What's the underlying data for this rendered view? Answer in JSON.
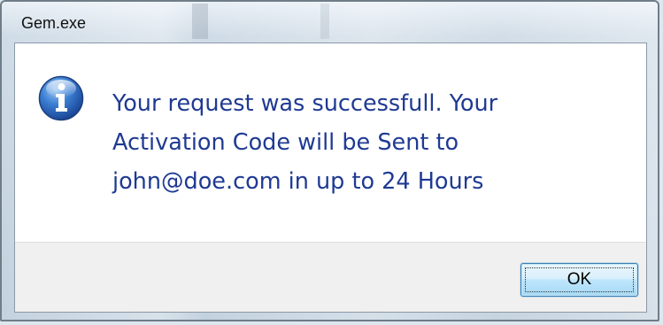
{
  "window": {
    "title": "Gem.exe"
  },
  "dialog": {
    "icon": "info-icon",
    "message": "Your request was successfull. Your\nActivation Code will be Sent to\njohn@doe.com in up to 24 Hours",
    "ok_label": "OK"
  },
  "colors": {
    "message_text": "#1f3a93",
    "button_border": "#3c7fb1",
    "icon_blue": "#2f6fc4"
  }
}
